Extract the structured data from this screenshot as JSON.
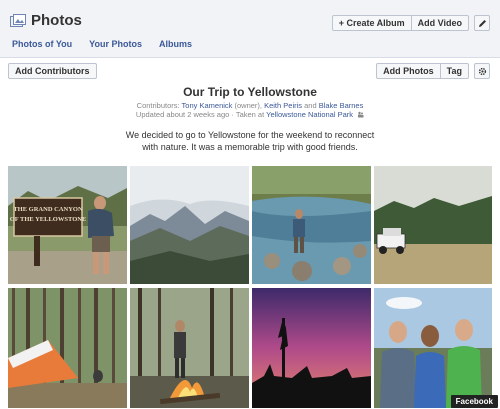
{
  "header": {
    "title": "Photos",
    "actions": {
      "create_album": "+ Create Album",
      "add_video": "Add Video"
    },
    "tabs": [
      "Photos of You",
      "Your Photos",
      "Albums"
    ]
  },
  "toolbar": {
    "add_contributors": "Add Contributors",
    "add_photos": "Add Photos",
    "tag": "Tag"
  },
  "album": {
    "title": "Our Trip to Yellowstone",
    "contributors_label": "Contributors: ",
    "contributor_1": "Tony Kamenick",
    "owner_suffix": " (owner), ",
    "contributor_2": "Keith Peiris",
    "and": " and ",
    "contributor_3": "Blake Barnes",
    "updated": "Updated about 2 weeks ago · Taken at ",
    "location": "Yellowstone National Park",
    "description": "We decided to go to Yellowstone for the weekend to reconnect with nature. It was a memorable trip with good friends."
  },
  "watermark": "Facebook",
  "colors": {
    "link": "#3b5998",
    "header_bg": "#f2f3f7"
  }
}
